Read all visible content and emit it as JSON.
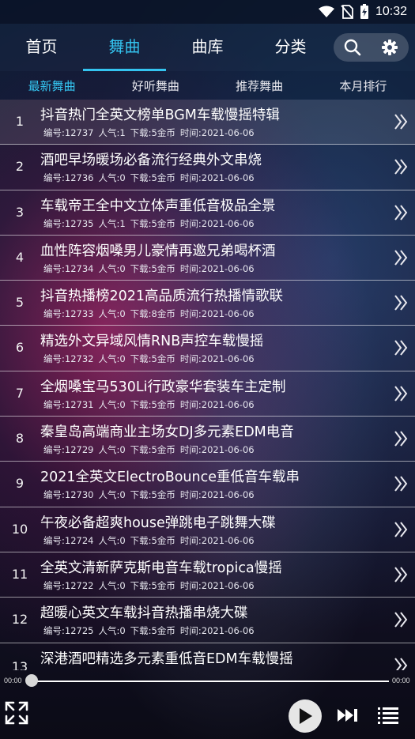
{
  "status": {
    "time": "10:32"
  },
  "nav": {
    "tabs": [
      "首页",
      "舞曲",
      "曲库",
      "分类"
    ],
    "active": 1
  },
  "subtabs": {
    "items": [
      "最新舞曲",
      "好听舞曲",
      "推荐舞曲",
      "本月排行"
    ],
    "active": 0
  },
  "songs": [
    {
      "num": "1",
      "title": "抖音热门全英文榜单BGM车载慢摇特辑",
      "id": "编号:12737",
      "pop": "人气:1",
      "dl": "下载:5金币",
      "time": "时间:2021-06-06"
    },
    {
      "num": "2",
      "title": "酒吧早场暖场必备流行经典外文串烧",
      "id": "编号:12736",
      "pop": "人气:0",
      "dl": "下载:5金币",
      "time": "时间:2021-06-06"
    },
    {
      "num": "3",
      "title": "车载帝王全中文立体声重低音极品全景",
      "id": "编号:12735",
      "pop": "人气:1",
      "dl": "下载:5金币",
      "time": "时间:2021-06-06"
    },
    {
      "num": "4",
      "title": "血性阵容烟嗓男儿豪情再邀兄弟喝杯酒",
      "id": "编号:12734",
      "pop": "人气:0",
      "dl": "下载:5金币",
      "time": "时间:2021-06-06"
    },
    {
      "num": "5",
      "title": "抖音热播榜2021高品质流行热播情歌联",
      "id": "编号:12733",
      "pop": "人气:0",
      "dl": "下载:8金币",
      "time": "时间:2021-06-06"
    },
    {
      "num": "6",
      "title": "精选外文异域风情RNB声控车载慢摇",
      "id": "编号:12732",
      "pop": "人气:0",
      "dl": "下载:5金币",
      "time": "时间:2021-06-06"
    },
    {
      "num": "7",
      "title": "全烟嗓宝马530Li行政豪华套装车主定制",
      "id": "编号:12731",
      "pop": "人气:0",
      "dl": "下载:5金币",
      "time": "时间:2021-06-06"
    },
    {
      "num": "8",
      "title": "秦皇岛高端商业主场女DJ多元素EDM电音",
      "id": "编号:12729",
      "pop": "人气:0",
      "dl": "下载:5金币",
      "time": "时间:2021-06-06"
    },
    {
      "num": "9",
      "title": "2021全英文ElectroBounce重低音车载串",
      "id": "编号:12730",
      "pop": "人气:0",
      "dl": "下载:5金币",
      "time": "时间:2021-06-06"
    },
    {
      "num": "10",
      "title": "午夜必备超爽house弹跳电子跳舞大碟",
      "id": "编号:12724",
      "pop": "人气:0",
      "dl": "下载:5金币",
      "time": "时间:2021-06-06"
    },
    {
      "num": "11",
      "title": "全英文清新萨克斯电音车载tropica慢摇",
      "id": "编号:12722",
      "pop": "人气:0",
      "dl": "下载:5金币",
      "time": "时间:2021-06-06"
    },
    {
      "num": "12",
      "title": "超暖心英文车载抖音热播串烧大碟",
      "id": "编号:12725",
      "pop": "人气:0",
      "dl": "下载:5金币",
      "time": "时间:2021-06-06"
    },
    {
      "num": "13",
      "title": "深港酒吧精选多元素重低音EDM车载慢摇",
      "id": "",
      "pop": "",
      "dl": "",
      "time": ""
    }
  ],
  "player": {
    "current": "00:00",
    "total": "00:00",
    "progress": 0
  },
  "icons": {
    "search": "search-icon",
    "settings": "gear-icon",
    "expand": "expand-icon",
    "play": "play-icon",
    "next": "next-icon",
    "playlist": "playlist-icon",
    "row_action": "double-chevron-right-icon"
  },
  "colors": {
    "accent": "#34c4f0"
  }
}
